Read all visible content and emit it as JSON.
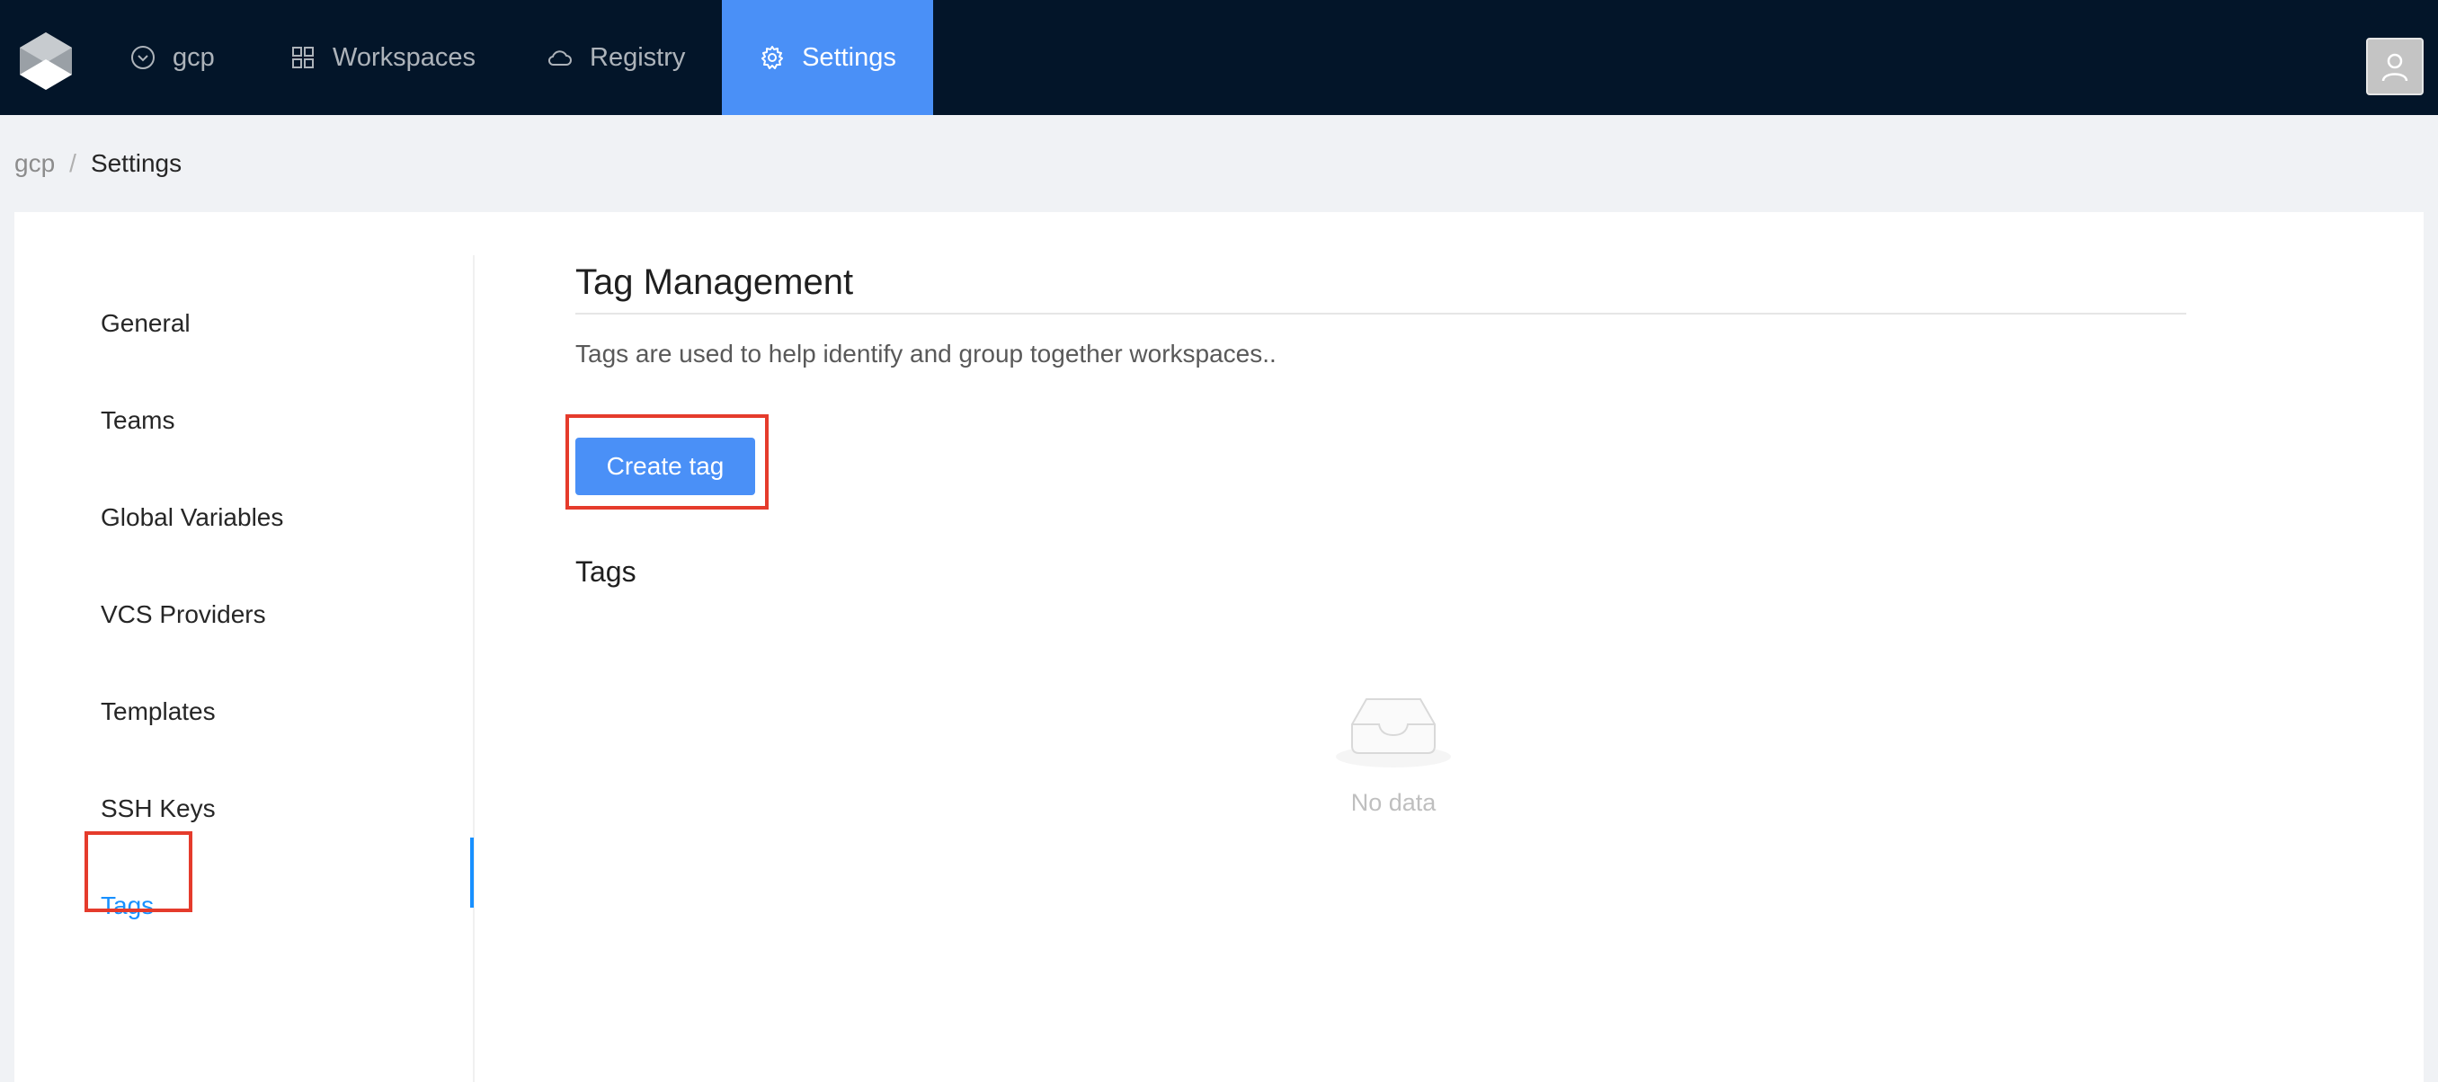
{
  "nav": {
    "org_label": "gcp",
    "workspaces_label": "Workspaces",
    "registry_label": "Registry",
    "settings_label": "Settings",
    "active": "Settings"
  },
  "breadcrumb": {
    "org": "gcp",
    "separator": "/",
    "current": "Settings"
  },
  "side_menu": {
    "items": [
      {
        "label": "General"
      },
      {
        "label": "Teams"
      },
      {
        "label": "Global Variables"
      },
      {
        "label": "VCS Providers"
      },
      {
        "label": "Templates"
      },
      {
        "label": "SSH Keys"
      },
      {
        "label": "Tags"
      }
    ],
    "active": "Tags"
  },
  "content": {
    "title": "Tag Management",
    "description": "Tags are used to help identify and group together workspaces..",
    "create_button_label": "Create tag",
    "section_title": "Tags",
    "empty_text": "No data"
  },
  "colors": {
    "topbar": "#031529",
    "accent": "#4a90f7",
    "active_link": "#1890ff",
    "highlight_box": "#e53b2c"
  }
}
